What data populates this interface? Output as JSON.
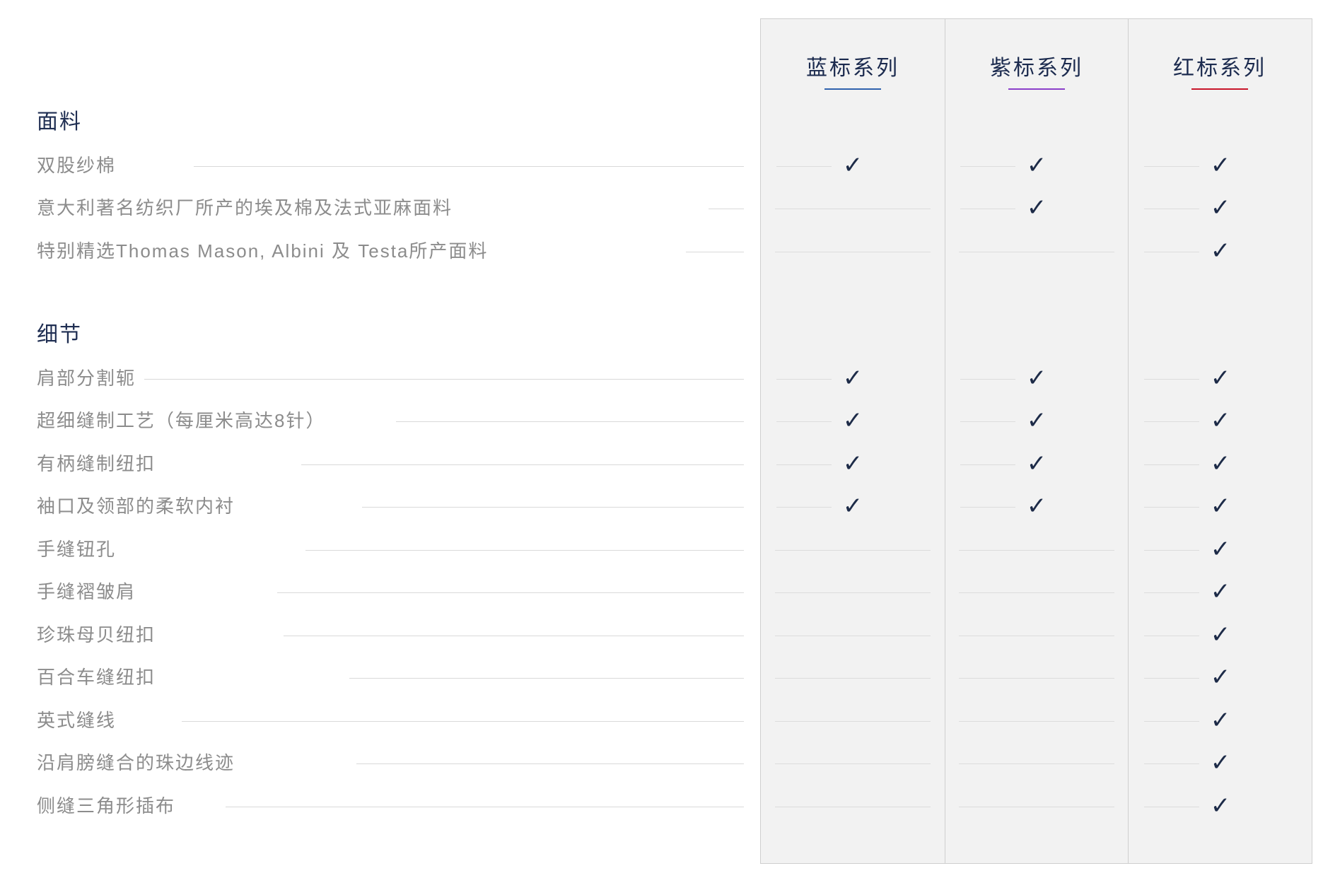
{
  "series": [
    {
      "name": "蓝标系列",
      "accent": "#2f62ad"
    },
    {
      "name": "紫标系列",
      "accent": "#8a3fc9"
    },
    {
      "name": "红标系列",
      "accent": "#c8162a"
    }
  ],
  "check_symbol": "✓",
  "colors": {
    "column_background": "#f2f2f2",
    "heading_navy": "#1f2e52",
    "label_gray": "#8c8c8c",
    "check_navy": "#1d2b48"
  },
  "sections": [
    {
      "title": "面料",
      "rows": [
        {
          "label": "双股纱棉",
          "available": [
            true,
            true,
            true
          ]
        },
        {
          "label": "意大利著名纺织厂所产的埃及棉及法式亚麻面料",
          "available": [
            false,
            true,
            true
          ]
        },
        {
          "label": "特别精选Thomas Mason, Albini 及 Testa所产面料",
          "available": [
            false,
            false,
            true
          ]
        }
      ]
    },
    {
      "title": "细节",
      "rows": [
        {
          "label": "肩部分割轭",
          "available": [
            true,
            true,
            true
          ]
        },
        {
          "label": "超细缝制工艺（每厘米高达8针）",
          "available": [
            true,
            true,
            true
          ]
        },
        {
          "label": "有柄缝制纽扣",
          "available": [
            true,
            true,
            true
          ]
        },
        {
          "label": "袖口及领部的柔软内衬",
          "available": [
            true,
            true,
            true
          ]
        },
        {
          "label": "手缝钮孔",
          "available": [
            false,
            false,
            true
          ]
        },
        {
          "label": "手缝褶皱肩",
          "available": [
            false,
            false,
            true
          ]
        },
        {
          "label": "珍珠母贝纽扣",
          "available": [
            false,
            false,
            true
          ]
        },
        {
          "label": "百合车缝纽扣",
          "available": [
            false,
            false,
            true
          ]
        },
        {
          "label": "英式缝线",
          "available": [
            false,
            false,
            true
          ]
        },
        {
          "label": "沿肩膀缝合的珠边线迹",
          "available": [
            false,
            false,
            true
          ]
        },
        {
          "label": "侧缝三角形插布",
          "available": [
            false,
            false,
            true
          ]
        }
      ]
    }
  ]
}
